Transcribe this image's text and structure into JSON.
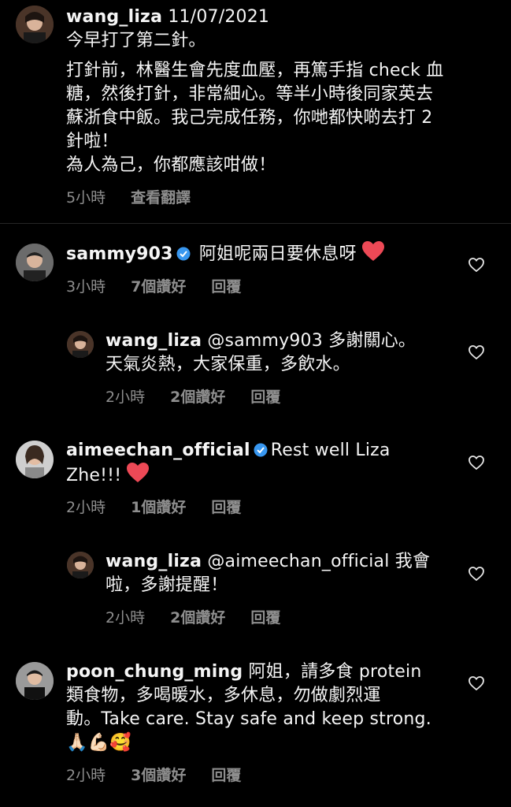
{
  "post": {
    "username": "wang_liza",
    "date": "11/07/2021",
    "lines": [
      "今早打了第二針。",
      "打針前，林醫生會先度血壓，再篤手指 check 血",
      "糖，然後打針，非常細心。等半小時後同家英去",
      "蘇浙食中飯。我己完成任務，你哋都快啲去打 2",
      "針啦！",
      "為人為己，你都應該咁做！"
    ],
    "time": "5小時",
    "translate": "查看翻譯"
  },
  "comments": [
    {
      "username": "sammy903",
      "text": "阿姐呢兩日要休息呀",
      "time": "3小時",
      "likes": "7個讚好",
      "reply": "回覆"
    },
    {
      "username": "wang_liza",
      "line1": "@sammy903 多謝關心。",
      "line2": "天氣炎熱，大家保重，多飲水。",
      "time": "2小時",
      "likes": "2個讚好",
      "reply": "回覆"
    },
    {
      "username": "aimeechan_official",
      "line1": "Rest well Liza",
      "line2": "Zhe!!!",
      "time": "2小時",
      "likes": "1個讚好",
      "reply": "回覆"
    },
    {
      "username": "wang_liza",
      "line1": "@aimeechan_official 我會",
      "line2": "啦，多謝提醒！",
      "time": "2小時",
      "likes": "2個讚好",
      "reply": "回覆"
    },
    {
      "username": "poon_chung_ming",
      "line1": "阿姐，請多食 protein",
      "line2": "類食物，多喝暖水，多休息，勿做劇烈運",
      "line3": "動。Take care. Stay safe and keep strong.",
      "line4": "🙏🏻💪🏻🥰",
      "time": "2小時",
      "likes": "3個讚好",
      "reply": "回覆"
    }
  ],
  "colors": {
    "verified": "#3897f0",
    "heart": "#ed4956",
    "meta": "#8e8e8e"
  },
  "icons": {
    "like": "heart-outline-icon",
    "verified": "verified-badge-icon"
  }
}
